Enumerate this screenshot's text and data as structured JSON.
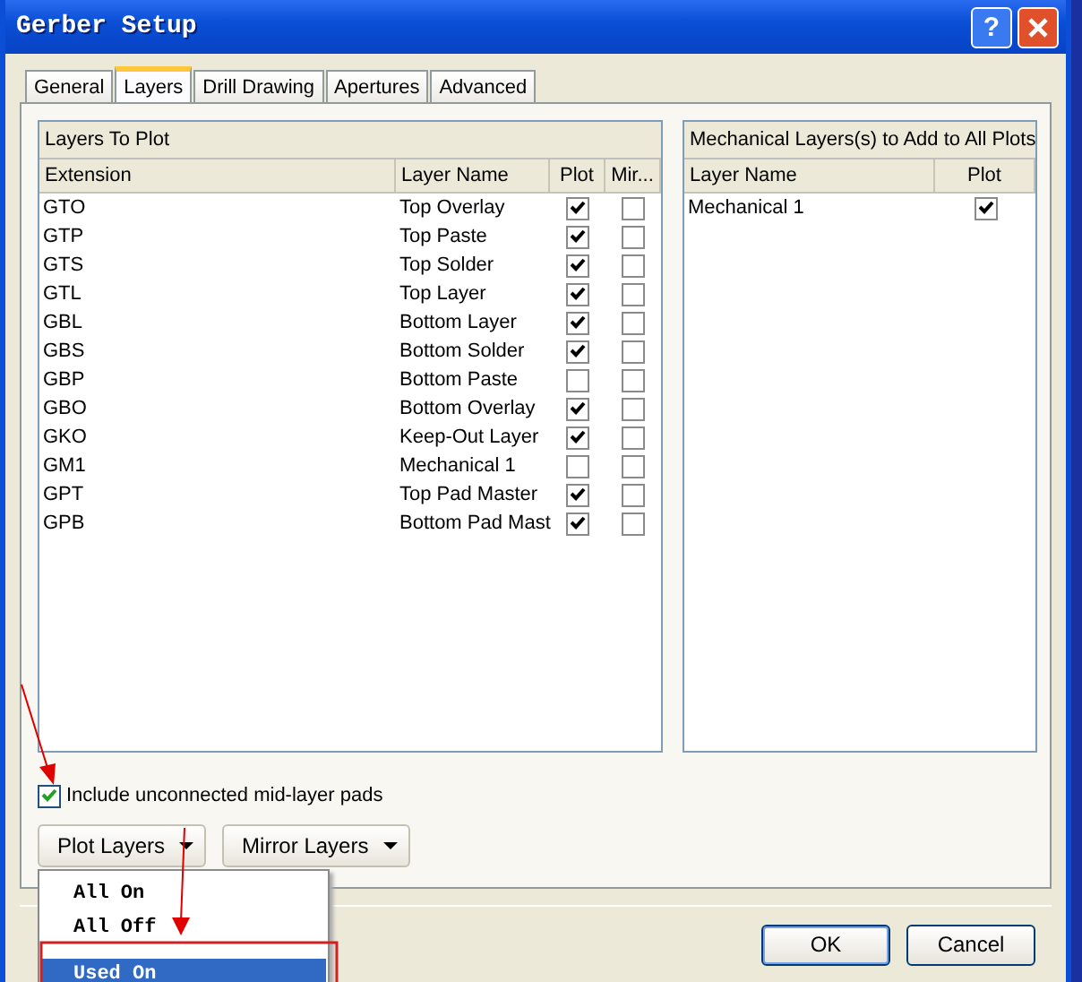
{
  "window": {
    "title": "Gerber Setup",
    "help": "?"
  },
  "tabs": [
    {
      "label": "General",
      "selected": false
    },
    {
      "label": "Layers",
      "selected": true
    },
    {
      "label": "Drill Drawing",
      "selected": false
    },
    {
      "label": "Apertures",
      "selected": false
    },
    {
      "label": "Advanced",
      "selected": false
    }
  ],
  "layers_to_plot": {
    "title": "Layers To Plot",
    "columns": [
      "Extension",
      "Layer Name",
      "Plot",
      "Mir..."
    ],
    "rows": [
      {
        "extension": "GTO",
        "layer_name": "Top Overlay",
        "plot": true,
        "mirror": false
      },
      {
        "extension": "GTP",
        "layer_name": "Top Paste",
        "plot": true,
        "mirror": false
      },
      {
        "extension": "GTS",
        "layer_name": "Top Solder",
        "plot": true,
        "mirror": false
      },
      {
        "extension": "GTL",
        "layer_name": "Top Layer",
        "plot": true,
        "mirror": false
      },
      {
        "extension": "GBL",
        "layer_name": "Bottom Layer",
        "plot": true,
        "mirror": false
      },
      {
        "extension": "GBS",
        "layer_name": "Bottom Solder",
        "plot": true,
        "mirror": false
      },
      {
        "extension": "GBP",
        "layer_name": "Bottom Paste",
        "plot": false,
        "mirror": false
      },
      {
        "extension": "GBO",
        "layer_name": "Bottom Overlay",
        "plot": true,
        "mirror": false
      },
      {
        "extension": "GKO",
        "layer_name": "Keep-Out Layer",
        "plot": true,
        "mirror": false
      },
      {
        "extension": "GM1",
        "layer_name": "Mechanical 1",
        "plot": false,
        "mirror": false
      },
      {
        "extension": "GPT",
        "layer_name": "Top Pad Master",
        "plot": true,
        "mirror": false
      },
      {
        "extension": "GPB",
        "layer_name": "Bottom Pad Mast",
        "plot": true,
        "mirror": false
      }
    ]
  },
  "mechanical_layers": {
    "title": "Mechanical Layers(s) to Add to All Plots",
    "columns": [
      "Layer Name",
      "Plot"
    ],
    "rows": [
      {
        "layer_name": "Mechanical 1",
        "plot": true
      }
    ]
  },
  "include_unconnected": {
    "label": "Include unconnected mid-layer pads",
    "checked": true
  },
  "dropdown_buttons": [
    "Plot Layers",
    "Mirror Layers"
  ],
  "menu": [
    {
      "label": "All On",
      "selected": false
    },
    {
      "label": "All Off",
      "selected": false
    },
    {
      "label": "Used On",
      "selected": true
    }
  ],
  "footer_buttons": [
    "OK",
    "Cancel"
  ]
}
